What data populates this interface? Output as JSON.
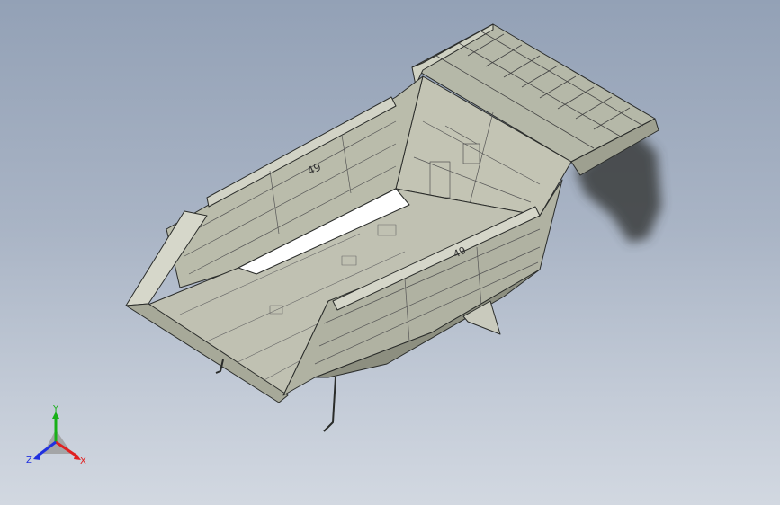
{
  "triad": {
    "x_label": "X",
    "y_label": "Y",
    "z_label": "Z",
    "x_color": "#e02020",
    "y_color": "#18b018",
    "z_color": "#2030e0"
  },
  "model": {
    "part_id_text": "49",
    "stamp_text": "49",
    "shade_light": "#d4d4c8",
    "shade_mid": "#b9bbaa",
    "shade_dark": "#8d8f80",
    "edge_color": "#2a2c2a",
    "highlight": "#ffffff"
  }
}
